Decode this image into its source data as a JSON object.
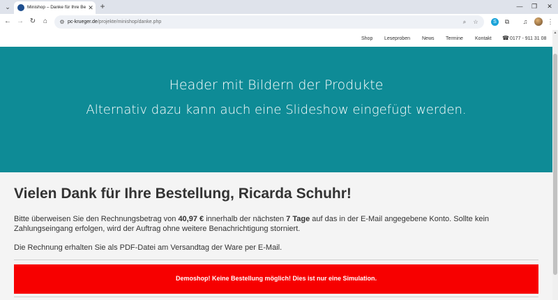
{
  "browser": {
    "tab": {
      "title": "Minishop – Danke für Ihre Bestellung"
    },
    "new_tab_symbol": "+",
    "address": {
      "host": "pc-krueger.de",
      "path": "/projekte/minishop/danke.php"
    }
  },
  "icons": {
    "tab_menu": "⌄",
    "tab_close": "✕",
    "minimize": "—",
    "maximize": "❐",
    "close": "✕",
    "back": "←",
    "forward": "→",
    "reload": "↻",
    "home": "⌂",
    "site_info": "⚙",
    "zoom": "⌕",
    "star": "☆",
    "extension_badge": "S",
    "puzzle": "⧉",
    "media": "♫",
    "menu": "⋮",
    "phone": "☎",
    "scroll_up": "▲"
  },
  "site": {
    "nav": {
      "shop": "Shop",
      "leseproben": "Leseproben",
      "news": "News",
      "termine": "Termine",
      "kontakt": "Kontakt",
      "phone": "0177 - 911 31 08"
    },
    "hero": {
      "line1": "Header mit Bildern der Produkte",
      "line2": "Alternativ dazu kann auch eine Slideshow eingefügt werden."
    },
    "heading": "Vielen Dank für Ihre Bestellung, Ricarda Schuhr!",
    "para1": {
      "t1": "Bitte überweisen Sie den Rechnungsbetrag von ",
      "amount": "40,97 €",
      "t2": " innerhalb der nächsten ",
      "days": "7 Tage",
      "t3": " auf das in der E-Mail angegebene Konto. Sollte kein Zahlungseingang erfolgen, wird der Auftrag ohne weitere Benachrichtigung storniert."
    },
    "para2": "Die Rechnung erhalten Sie als PDF-Datei am Versandtag der Ware per E-Mail.",
    "alert": "Demoshop! Keine Bestellung möglich! Dies ist nur eine Simulation.",
    "colors": {
      "hero_bg": "#0e8b96",
      "alert_bg": "#f70000"
    }
  }
}
